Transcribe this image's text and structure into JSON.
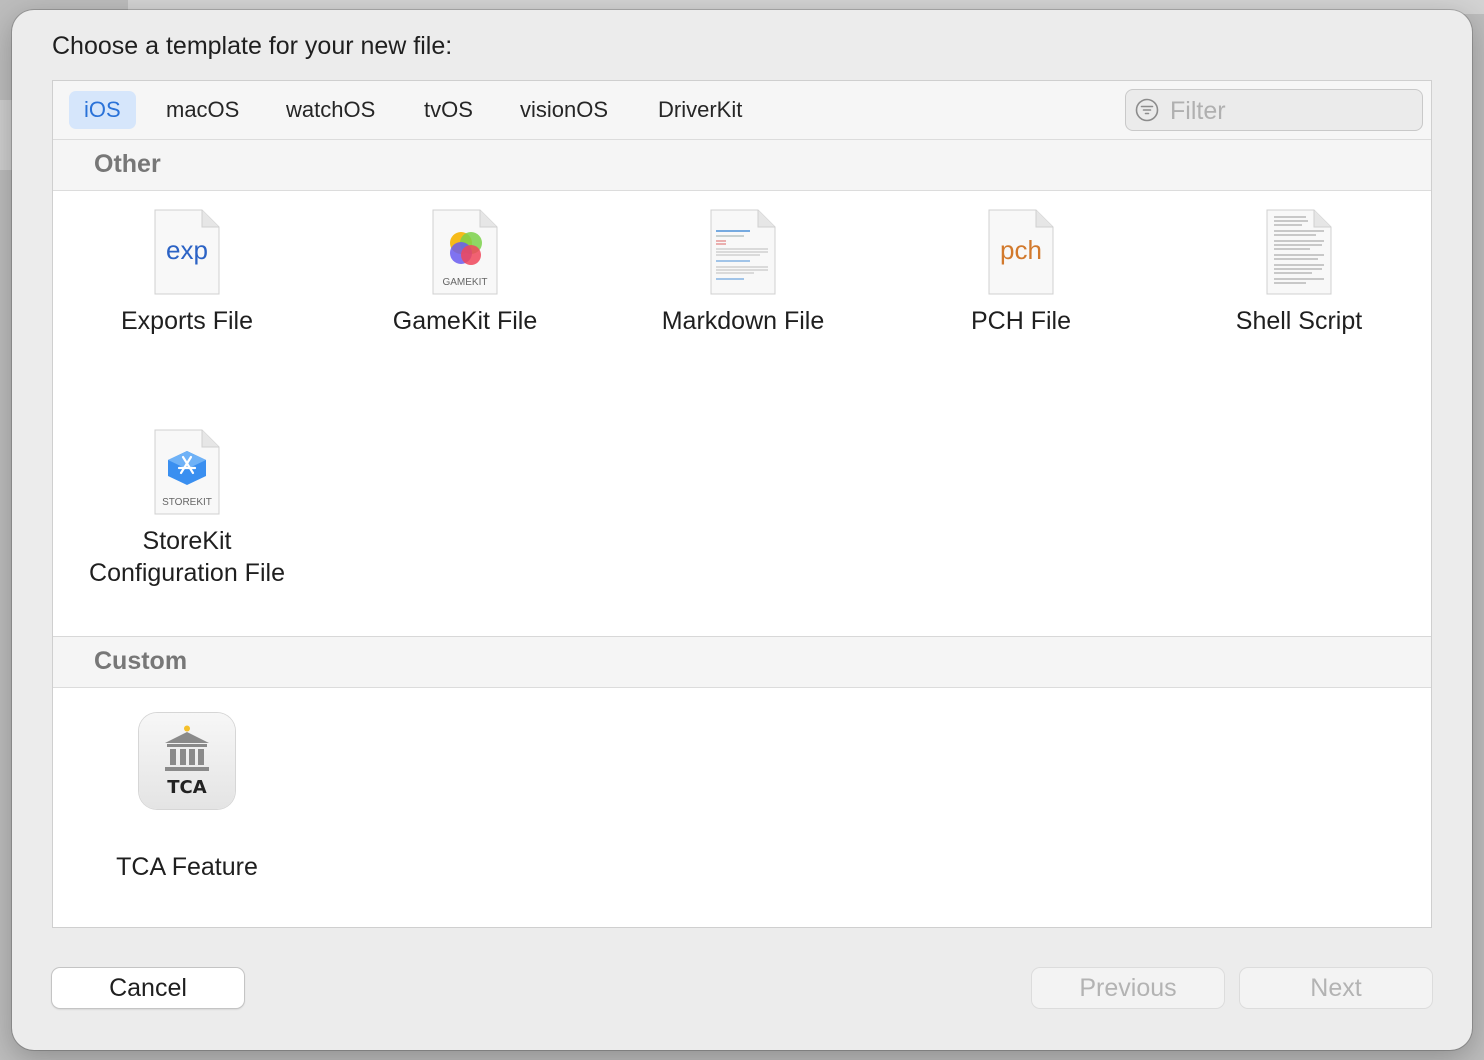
{
  "dialog": {
    "title": "Choose a template for your new file:"
  },
  "tabs": [
    {
      "label": "iOS",
      "selected": true
    },
    {
      "label": "macOS",
      "selected": false
    },
    {
      "label": "watchOS",
      "selected": false
    },
    {
      "label": "tvOS",
      "selected": false
    },
    {
      "label": "visionOS",
      "selected": false
    },
    {
      "label": "DriverKit",
      "selected": false
    }
  ],
  "filter": {
    "placeholder": "Filter",
    "value": "",
    "icon": "filter-icon"
  },
  "sections": [
    {
      "title": "Other",
      "items": [
        {
          "label": "Exports File",
          "icon": "exports-file-icon",
          "icon_text": "exp",
          "icon_text_color": "#2c63c5"
        },
        {
          "label": "GameKit File",
          "icon": "gamekit-file-icon",
          "icon_text": "GAMEKIT"
        },
        {
          "label": "Markdown File",
          "icon": "markdown-file-icon"
        },
        {
          "label": "PCH File",
          "icon": "pch-file-icon",
          "icon_text": "pch",
          "icon_text_color": "#d2792c"
        },
        {
          "label": "Shell Script",
          "icon": "shell-script-icon"
        },
        {
          "label": "StoreKit Configuration File",
          "label_lines": [
            "StoreKit",
            "Configuration File"
          ],
          "icon": "storekit-file-icon",
          "icon_text": "STOREKIT"
        }
      ]
    },
    {
      "title": "Custom",
      "items": [
        {
          "label": "TCA Feature",
          "icon": "tca-feature-icon",
          "icon_text": "TCA"
        }
      ]
    }
  ],
  "buttons": {
    "cancel": "Cancel",
    "previous": "Previous",
    "next": "Next",
    "previous_enabled": false,
    "next_enabled": false
  },
  "colors": {
    "accent": "#2a72d8",
    "selected_tab_bg": "#d6e6fb",
    "dialog_bg": "#ececec"
  }
}
